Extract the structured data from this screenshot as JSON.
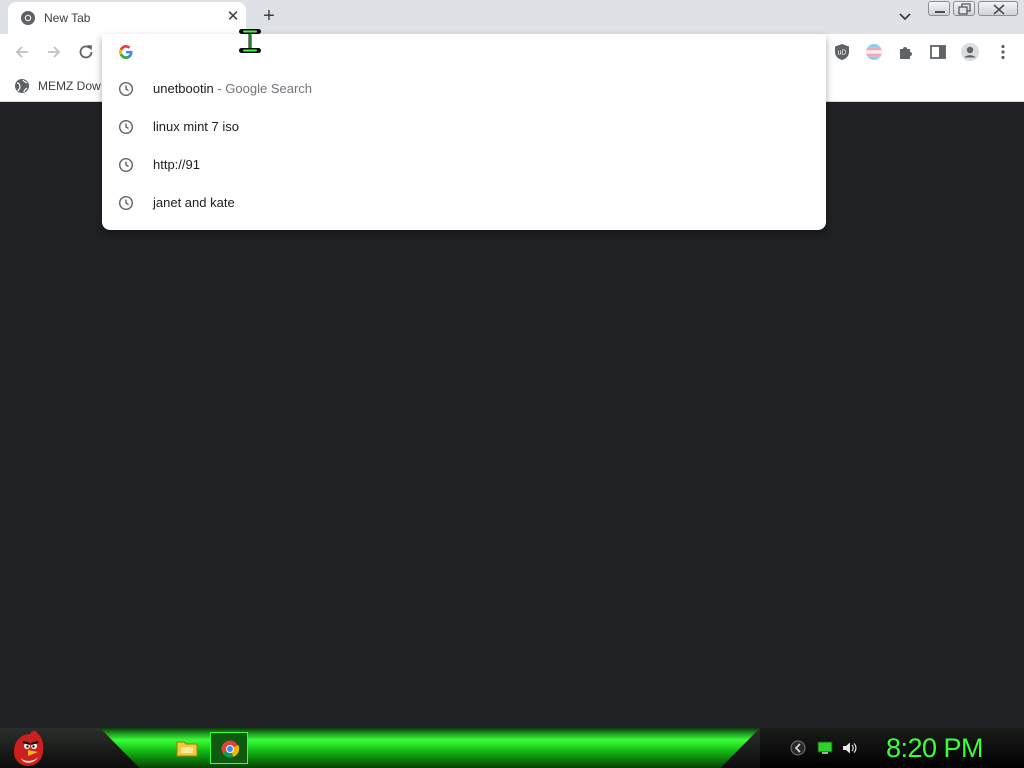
{
  "browser": {
    "tab": {
      "title": "New Tab"
    },
    "new_tab_symbol": "+",
    "close_symbol": "✕"
  },
  "bookmarks": {
    "items": [
      {
        "label": "MEMZ Dow"
      }
    ]
  },
  "omnibox": {
    "value": "",
    "suggestions": [
      {
        "text": "unetbootin",
        "separator": " - ",
        "sub": "Google Search",
        "icon": "history-clock-icon"
      },
      {
        "text": "linux mint 7 iso",
        "icon": "history-clock-icon"
      },
      {
        "text": "http://91",
        "icon": "history-clock-icon"
      },
      {
        "text": "janet and kate",
        "icon": "history-clock-icon"
      }
    ]
  },
  "toolbar": {
    "extensions": [
      "ublock-icon",
      "pride-flag-extension-icon",
      "puzzle-extensions-icon",
      "side-panel-icon",
      "profile-avatar-icon",
      "kebab-menu-icon"
    ]
  },
  "taskbar": {
    "clock": "8:20 PM",
    "apps": [
      "file-explorer-icon",
      "chrome-icon"
    ],
    "tray": [
      "back-arrow-icon",
      "network-icon",
      "volume-icon"
    ]
  },
  "colors": {
    "page_background": "#202124",
    "taskbar_accent": "#3cff3c",
    "chrome_tabstrip": "#dee1e6"
  }
}
